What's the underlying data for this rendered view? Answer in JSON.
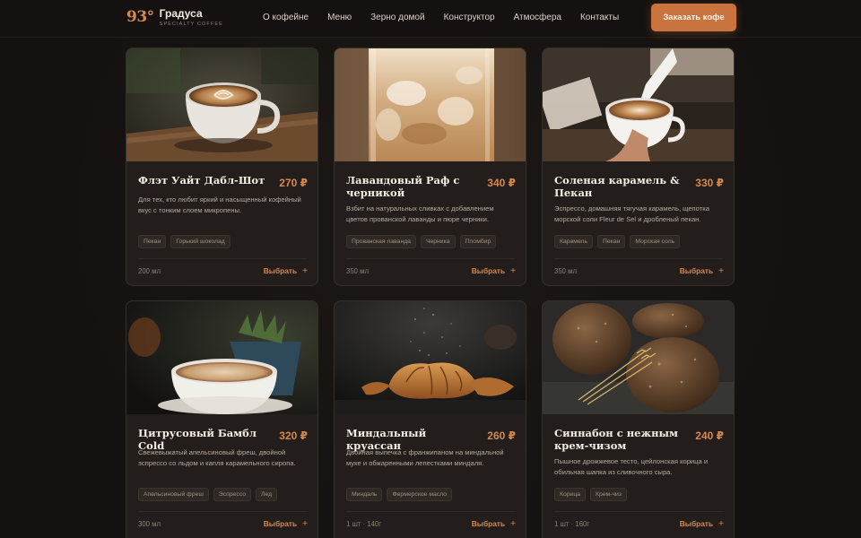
{
  "brand": {
    "mark": "93°",
    "name": "Градуса",
    "tagline": "SPECIALTY COFFEE"
  },
  "nav": [
    {
      "label": "О кофейне"
    },
    {
      "label": "Меню"
    },
    {
      "label": "Зерно домой"
    },
    {
      "label": "Конструктор"
    },
    {
      "label": "Атмосфера"
    },
    {
      "label": "Контакты"
    }
  ],
  "order_button": "Заказать кофе",
  "products": [
    {
      "title": "Флэт Уайт Дабл-Шот",
      "price": "270 ₽",
      "description": "Для тех, кто любит яркий и насыщенный кофейный вкус с тонким слоем микропены.",
      "tags": [
        "Пекан",
        "Горький шоколад"
      ],
      "volume": "200 мл",
      "action": "Выбрать",
      "image": "flat-white-cup-photo"
    },
    {
      "title": "Лавандовый Раф с черникой",
      "price": "340 ₽",
      "description": "Взбит на натуральных сливках с добавлением цветов прованской лаванды и пюре черники.",
      "tags": [
        "Прованская лаванда",
        "Черника",
        "Пломбир"
      ],
      "volume": "350 мл",
      "action": "Выбрать",
      "image": "iced-raf-glass-photo"
    },
    {
      "title": "Соленая карамель & Пекан",
      "price": "330 ₽",
      "description": "Эспрессо, домашняя тягучая карамель, щепотка морской соли Fleur de Sel и дробленый пекан.",
      "tags": [
        "Карамель",
        "Пекан",
        "Морская соль"
      ],
      "volume": "350 мл",
      "action": "Выбрать",
      "image": "latte-art-pour-photo"
    },
    {
      "title": "Цитрусовый Бамбл Cold",
      "price": "320 ₽",
      "description": "Свежевыжатый апельсиновый фреш, двойной эспрессо со льдом и капля карамельного сиропа.",
      "tags": [
        "Апельсиновый фреш",
        "Эспрессо",
        "Лед"
      ],
      "volume": "300 мл",
      "action": "Выбрать",
      "image": "cappuccino-cup-photo"
    },
    {
      "title": "Миндальный круассан",
      "price": "260 ₽",
      "description": "Двойная выпечка с франжипаном на миндальной муке и обжаренными лепестками миндаля.",
      "tags": [
        "Миндаль",
        "Фермерское масло"
      ],
      "volume": "1 шт · 140г",
      "action": "Выбрать",
      "image": "croissant-photo"
    },
    {
      "title": "Синнабон с нежным крем-чизом",
      "price": "240 ₽",
      "description": "Пышное дрожжевое тесто, цейлонская корица и обильная шапка из сливочного сыра.",
      "tags": [
        "Корица",
        "Крем-чиз"
      ],
      "volume": "1 шт · 160г",
      "action": "Выбрать",
      "image": "rye-bread-loaves-photo"
    }
  ],
  "colors": {
    "background": "#161210",
    "card": "#231e1b",
    "accent": "#d4894f",
    "button": "#c9743e"
  }
}
